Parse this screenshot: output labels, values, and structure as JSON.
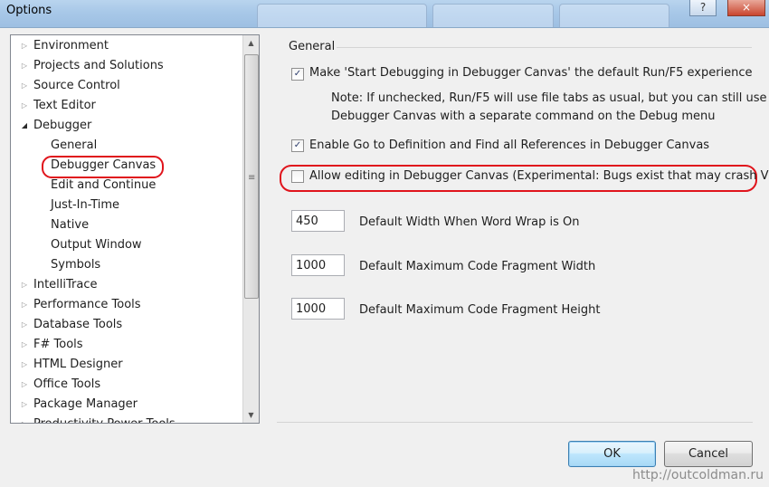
{
  "window": {
    "title": "Options"
  },
  "titlebar": {
    "help_label": "?",
    "close_label": "×"
  },
  "tree": {
    "items": [
      {
        "label": "Environment",
        "indent": 0,
        "expander": "collapsed"
      },
      {
        "label": "Projects and Solutions",
        "indent": 0,
        "expander": "collapsed"
      },
      {
        "label": "Source Control",
        "indent": 0,
        "expander": "collapsed"
      },
      {
        "label": "Text Editor",
        "indent": 0,
        "expander": "collapsed"
      },
      {
        "label": "Debugger",
        "indent": 0,
        "expander": "expanded"
      },
      {
        "label": "General",
        "indent": 1,
        "expander": "none"
      },
      {
        "label": "Debugger Canvas",
        "indent": 1,
        "expander": "none",
        "selected": true
      },
      {
        "label": "Edit and Continue",
        "indent": 1,
        "expander": "none"
      },
      {
        "label": "Just-In-Time",
        "indent": 1,
        "expander": "none"
      },
      {
        "label": "Native",
        "indent": 1,
        "expander": "none"
      },
      {
        "label": "Output Window",
        "indent": 1,
        "expander": "none"
      },
      {
        "label": "Symbols",
        "indent": 1,
        "expander": "none"
      },
      {
        "label": "IntelliTrace",
        "indent": 0,
        "expander": "collapsed"
      },
      {
        "label": "Performance Tools",
        "indent": 0,
        "expander": "collapsed"
      },
      {
        "label": "Database Tools",
        "indent": 0,
        "expander": "collapsed"
      },
      {
        "label": "F# Tools",
        "indent": 0,
        "expander": "collapsed"
      },
      {
        "label": "HTML Designer",
        "indent": 0,
        "expander": "collapsed"
      },
      {
        "label": "Office Tools",
        "indent": 0,
        "expander": "collapsed"
      },
      {
        "label": "Package Manager",
        "indent": 0,
        "expander": "collapsed"
      },
      {
        "label": "Productivity Power Tools",
        "indent": 0,
        "expander": "collapsed"
      }
    ]
  },
  "settings": {
    "group_title": "General",
    "make_default": {
      "label": "Make 'Start Debugging in Debugger Canvas' the default Run/F5 experience",
      "checked": true
    },
    "note_line1": "Note: If unchecked, Run/F5 will use file tabs as usual, but you can still use",
    "note_line2": "Debugger Canvas with a separate command on the Debug menu",
    "goto_definition": {
      "label": "Enable Go to Definition and Find all References in Debugger Canvas",
      "checked": true
    },
    "allow_editing": {
      "label": "Allow editing in Debugger Canvas (Experimental: Bugs exist that may crash VS)",
      "checked": false
    },
    "word_wrap_width": {
      "value": "450",
      "label": "Default Width When Word Wrap is On"
    },
    "max_fragment_width": {
      "value": "1000",
      "label": "Default Maximum Code Fragment Width"
    },
    "max_fragment_height": {
      "value": "1000",
      "label": "Default Maximum Code Fragment Height"
    }
  },
  "buttons": {
    "ok": "OK",
    "cancel": "Cancel"
  },
  "watermark": "http://outcoldman.ru",
  "colors": {
    "highlight_ring": "#e0141c",
    "check_mark": "#2b3b6b"
  }
}
